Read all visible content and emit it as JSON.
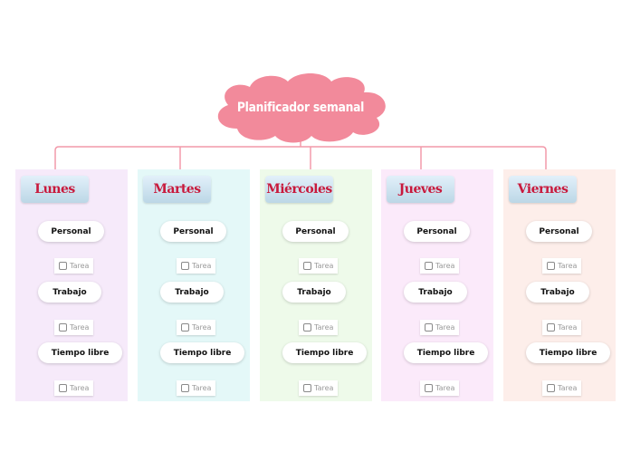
{
  "diagram": {
    "title": "Planificador semanal",
    "colors": {
      "cloud": "#f28a9b",
      "connector": "#f29aaa",
      "day_text": "#c8193c"
    },
    "days": [
      {
        "label": "Lunes",
        "background": "#f6eafa",
        "categories": [
          {
            "label": "Personal",
            "task": {
              "label": "Tarea",
              "checked": false
            }
          },
          {
            "label": "Trabajo",
            "task": {
              "label": "Tarea",
              "checked": false
            }
          },
          {
            "label": "Tiempo libre",
            "task": {
              "label": "Tarea",
              "checked": false
            }
          }
        ]
      },
      {
        "label": "Martes",
        "background": "#e4f8f8",
        "categories": [
          {
            "label": "Personal",
            "task": {
              "label": "Tarea",
              "checked": false
            }
          },
          {
            "label": "Trabajo",
            "task": {
              "label": "Tarea",
              "checked": false
            }
          },
          {
            "label": "Tiempo libre",
            "task": {
              "label": "Tarea",
              "checked": false
            }
          }
        ]
      },
      {
        "label": "Miércoles",
        "background": "#eefaea",
        "categories": [
          {
            "label": "Personal",
            "task": {
              "label": "Tarea",
              "checked": false
            }
          },
          {
            "label": "Trabajo",
            "task": {
              "label": "Tarea",
              "checked": false
            }
          },
          {
            "label": "Tiempo libre",
            "task": {
              "label": "Tarea",
              "checked": false
            }
          }
        ]
      },
      {
        "label": "Jueves",
        "background": "#fbeafa",
        "categories": [
          {
            "label": "Personal",
            "task": {
              "label": "Tarea",
              "checked": false
            }
          },
          {
            "label": "Trabajo",
            "task": {
              "label": "Tarea",
              "checked": false
            }
          },
          {
            "label": "Tiempo libre",
            "task": {
              "label": "Tarea",
              "checked": false
            }
          }
        ]
      },
      {
        "label": "Viernes",
        "background": "#fdeeea",
        "categories": [
          {
            "label": "Personal",
            "task": {
              "label": "Tarea",
              "checked": false
            }
          },
          {
            "label": "Trabajo",
            "task": {
              "label": "Tarea",
              "checked": false
            }
          },
          {
            "label": "Tiempo libre",
            "task": {
              "label": "Tarea",
              "checked": false
            }
          }
        ]
      }
    ]
  }
}
